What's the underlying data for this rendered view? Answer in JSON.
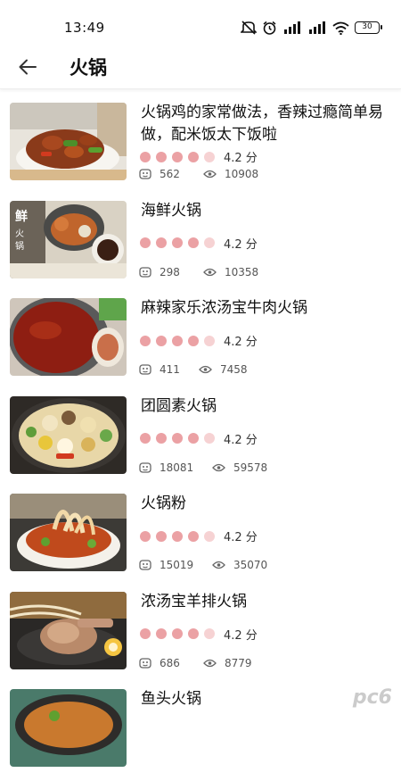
{
  "status_bar": {
    "time": "13:49",
    "battery": "30"
  },
  "header": {
    "title": "火锅"
  },
  "recipes": [
    {
      "name": "火锅鸡的家常做法，香辣过瘾简单易做，配米饭太下饭啦",
      "rating": "4.2 分",
      "likes": "562",
      "views": "10908"
    },
    {
      "name": "海鲜火锅",
      "rating": "4.2 分",
      "likes": "298",
      "views": "10358"
    },
    {
      "name": "麻辣家乐浓汤宝牛肉火锅",
      "rating": "4.2 分",
      "likes": "411",
      "views": "7458"
    },
    {
      "name": "团圆素火锅",
      "rating": "4.2 分",
      "likes": "18081",
      "views": "59578"
    },
    {
      "name": "火锅粉",
      "rating": "4.2 分",
      "likes": "15019",
      "views": "35070"
    },
    {
      "name": "浓汤宝羊排火锅",
      "rating": "4.2 分",
      "likes": "686",
      "views": "8779"
    },
    {
      "name": "鱼头火锅"
    }
  ],
  "colors": {
    "rating_dot": "#eba1a4",
    "rating_dot_light": "#f6d2d3"
  },
  "icons": [
    "back-arrow-icon",
    "eye-icon",
    "like-face-icon"
  ],
  "watermark": "pc6"
}
